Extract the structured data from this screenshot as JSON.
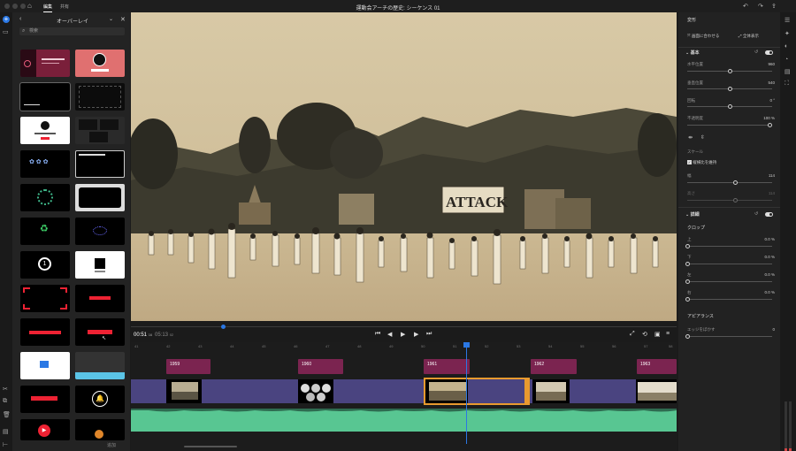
{
  "topbar": {
    "tab_edit": "編集",
    "tab_share": "共有",
    "title": "運動会アーチの歴史: シーケンス 01"
  },
  "left_panel": {
    "title": "オーバーレイ",
    "search_placeholder": "検索",
    "add_label": "追加"
  },
  "viewer": {
    "sign_text": "ATTACK"
  },
  "transport": {
    "current_time": "00:51",
    "current_frames": "16",
    "duration": "05:13",
    "duration_frames": "02",
    "progress_fraction": 0.165
  },
  "timeline": {
    "ruler": [
      "41",
      "42",
      "43",
      "44",
      "45",
      "46",
      "47",
      "48",
      "49",
      "50",
      "51",
      "52",
      "53",
      "54",
      "55",
      "56",
      "57",
      "58"
    ],
    "year_clips": [
      "1959",
      "1960",
      "1961",
      "1962",
      "1963"
    ]
  },
  "right_panel": {
    "title": "変形",
    "fit_button": "画面に合わせる",
    "full_button": "全体表示",
    "basic_section": "基本",
    "h_position_label": "水平位置",
    "h_position_value": "960",
    "v_position_label": "垂直位置",
    "v_position_value": "540",
    "rotation_label": "回転",
    "rotation_value": "0 °",
    "opacity_label": "不透明度",
    "opacity_value": "100 %",
    "scale_label": "スケール",
    "keep_ratio_label": "縦横比を維持",
    "width_label": "幅",
    "width_value": "114",
    "height_label": "高さ",
    "height_value": "114",
    "detail_section": "詳細",
    "crop_label": "クロップ",
    "crop_top_label": "上",
    "crop_top_value": "0.0 %",
    "crop_bottom_label": "下",
    "crop_bottom_value": "0.0 %",
    "crop_left_label": "左",
    "crop_left_value": "0.0 %",
    "crop_right_label": "右",
    "crop_right_value": "0.0 %",
    "appearance_label": "アピアランス",
    "edge_blur_label": "エッジをぼかす",
    "edge_blur_value": "0"
  },
  "colors": {
    "accent": "#2b78e4",
    "year_clip": "#7b2450",
    "video_track": "#4a4480",
    "audio_track": "#58c692",
    "selected_clip": "#e89a2f"
  }
}
